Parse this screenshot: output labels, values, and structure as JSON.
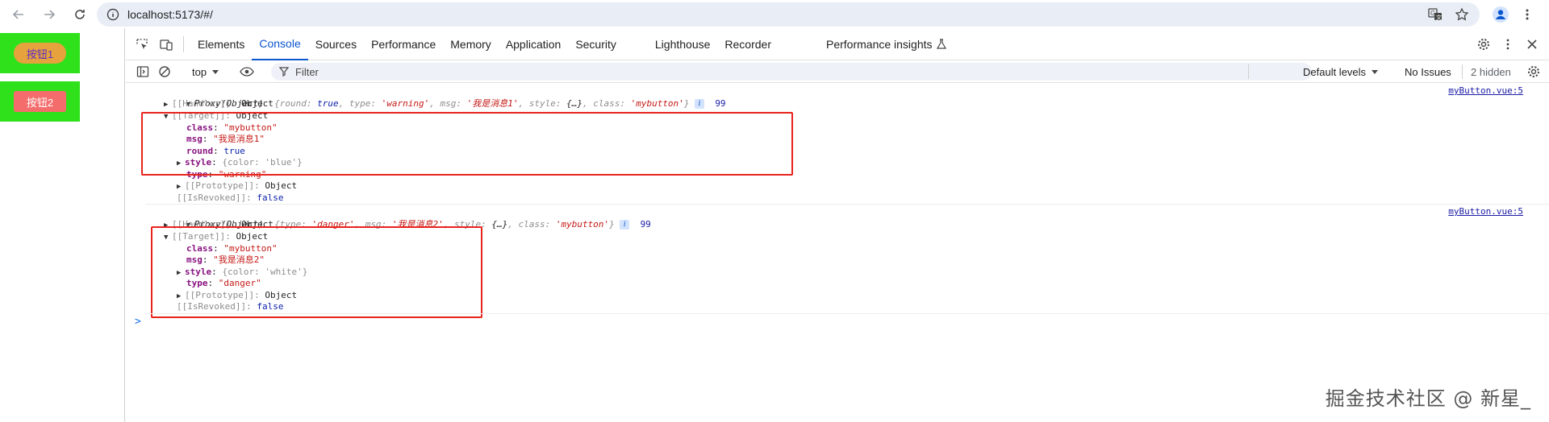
{
  "browser": {
    "url": "localhost:5173/#/"
  },
  "page": {
    "button1_label": "按钮1",
    "button2_label": "按钮2"
  },
  "devtools": {
    "tabs": [
      "Elements",
      "Console",
      "Sources",
      "Performance",
      "Memory",
      "Application",
      "Security",
      "Lighthouse",
      "Recorder",
      "Performance insights"
    ],
    "active_tab": "Console",
    "toolbar": {
      "context": "top",
      "filter_placeholder": "Filter",
      "levels": "Default levels",
      "issues": "No Issues",
      "hidden": "2 hidden"
    }
  },
  "console": {
    "entries": [
      {
        "header_prefix": "Proxy(Object)",
        "header_preview_open": "{",
        "p1k": "round",
        "p1v": "true",
        "p2k": "type",
        "p2v": "'warning'",
        "p3k": "msg",
        "p3v": "'我是消息1'",
        "p4k": "style",
        "p4v": "{…}",
        "p5k": "class",
        "p5v": "'mybutton'",
        "header_preview_close": "}",
        "count": "99",
        "source": "myButton.vue:5",
        "handler": "[[Handler]]",
        "handler_val": "Object",
        "target": "[[Target]]",
        "target_val": "Object",
        "props": [
          {
            "k": "class",
            "v": "\"mybutton\""
          },
          {
            "k": "msg",
            "v": "\"我是消息1\""
          },
          {
            "k": "round",
            "v": "true"
          },
          {
            "k": "style",
            "v": "{color: 'blue'}"
          },
          {
            "k": "type",
            "v": "\"warning\""
          }
        ],
        "prototype": "[[Prototype]]",
        "prototype_val": "Object",
        "revoked": "[[IsRevoked]]",
        "revoked_val": "false"
      },
      {
        "header_prefix": "Proxy(Object)",
        "header_preview_open": "{",
        "p1k": "type",
        "p1v": "'danger'",
        "p2k": "msg",
        "p2v": "'我是消息2'",
        "p3k": "style",
        "p3v": "{…}",
        "p4k": "class",
        "p4v": "'mybutton'",
        "header_preview_close": "}",
        "count": "99",
        "source": "myButton.vue:5",
        "handler": "[[Handler]]",
        "handler_val": "Object",
        "target": "[[Target]]",
        "target_val": "Object",
        "props": [
          {
            "k": "class",
            "v": "\"mybutton\""
          },
          {
            "k": "msg",
            "v": "\"我是消息2\""
          },
          {
            "k": "style",
            "v": "{color: 'white'}"
          },
          {
            "k": "type",
            "v": "\"danger\""
          }
        ],
        "prototype": "[[Prototype]]",
        "prototype_val": "Object",
        "revoked": "[[IsRevoked]]",
        "revoked_val": "false"
      }
    ],
    "prompt": ">"
  },
  "watermark": "掘金技术社区 @ 新星_",
  "colors": {
    "accent": "#0b57d0",
    "highlight_box": "#e8231c",
    "page_green": "#2ee11a",
    "warning_button": "#e6a23c",
    "danger_button": "#f56c6c"
  }
}
